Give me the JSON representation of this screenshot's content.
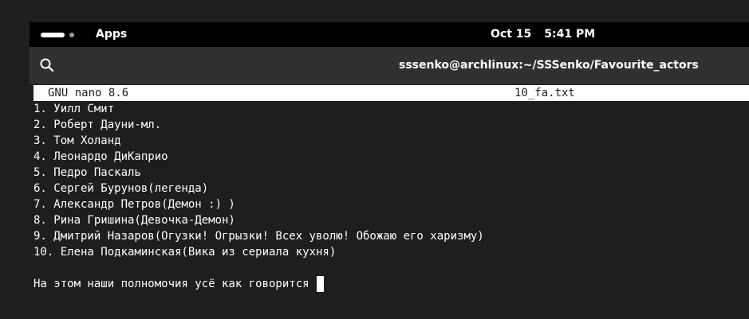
{
  "topbar": {
    "apps_label": "Apps",
    "date": "Oct 15",
    "time": "5:41 PM"
  },
  "window": {
    "title": "sssenko@archlinux:~/SSSenko/Favourite_actors",
    "search_icon": "search-icon"
  },
  "nano": {
    "version": "GNU nano 8.6",
    "filename": "10_fa.txt",
    "lines": [
      "1. Уилл Смит",
      "2. Роберт Дауни-мл.",
      "3. Том Холанд",
      "4. Леонардо ДиКаприо",
      "5. Педро Паскаль",
      "6. Сергей Бурунов(легенда)",
      "7. Александр Петров(Демон :) )",
      "8. Рина Гришина(Девочка-Демон)",
      "9. Дмитрий Назаров(Огузки! Огрызки! Всех уволю! Обожаю его харизму)",
      "10. Елена Подкаминская(Вика из сериала кухня)"
    ],
    "last_line": "На этом наши полномочия усё как говорится"
  }
}
